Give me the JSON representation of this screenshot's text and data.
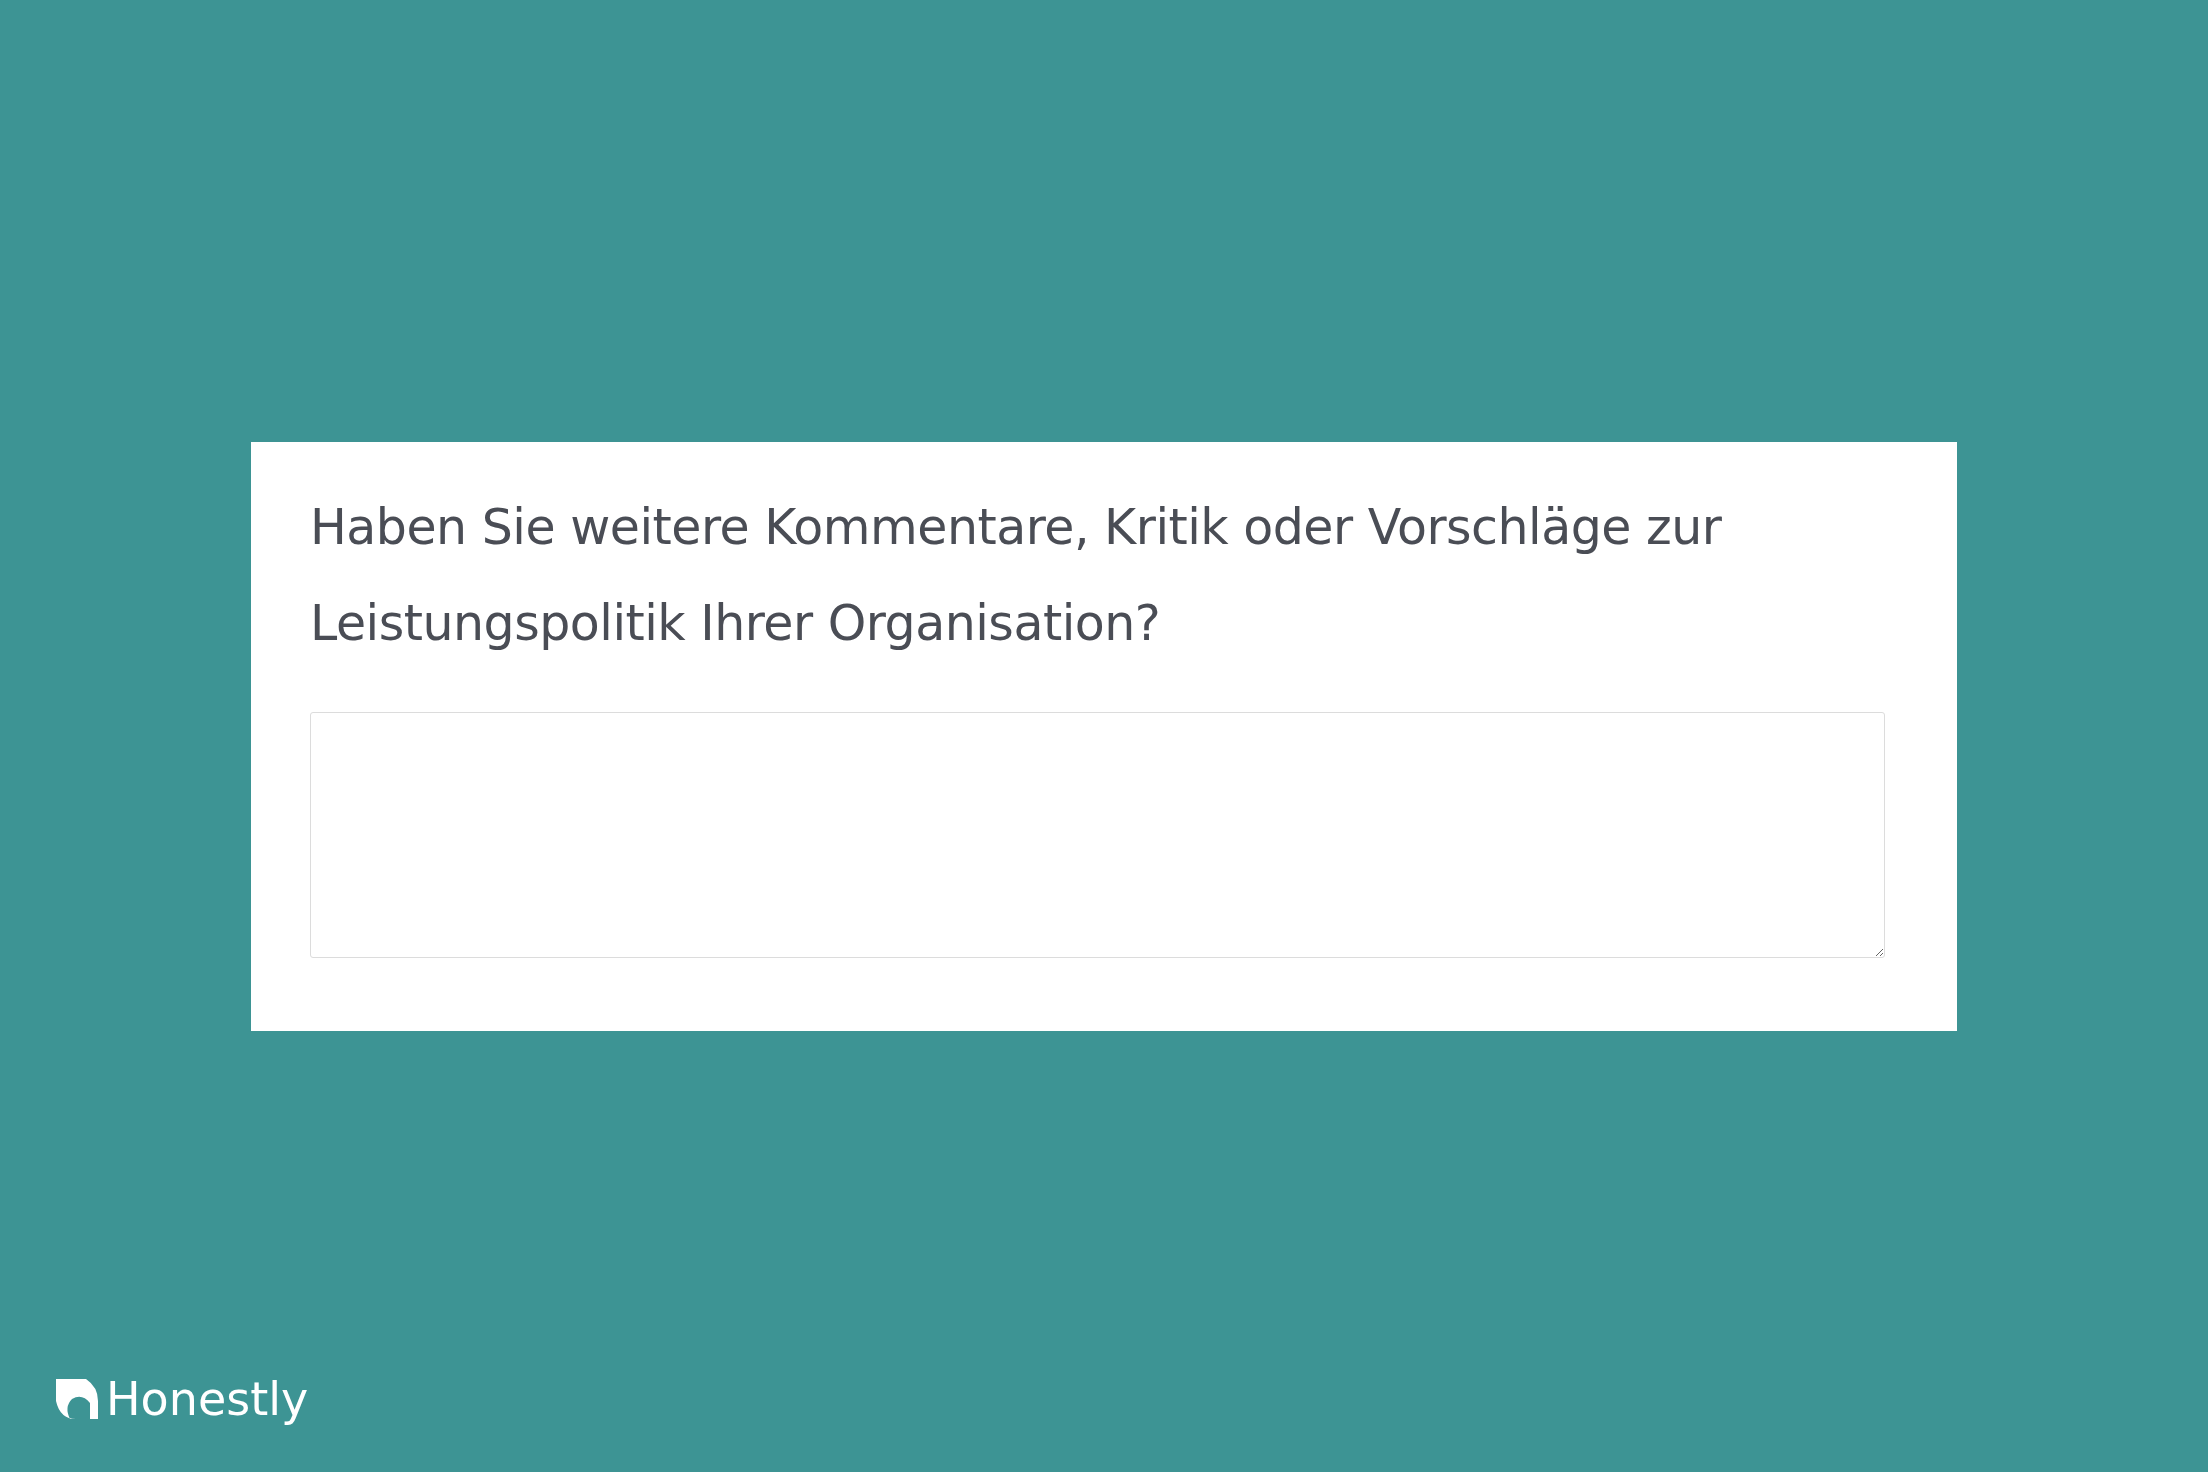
{
  "question": "Haben Sie weitere Kommentare, Kritik oder Vorschläge zur Leistungspolitik Ihrer Organisation?",
  "brand": "Honestly"
}
